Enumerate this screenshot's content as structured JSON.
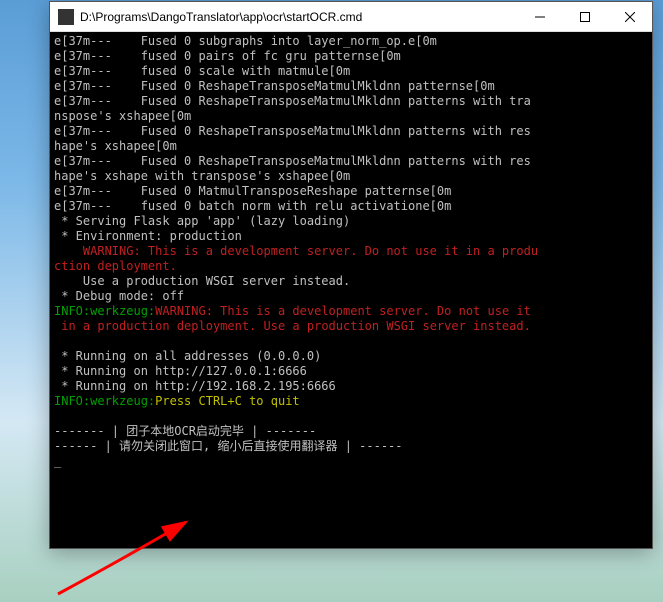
{
  "window": {
    "title": "D:\\Programs\\DangoTranslator\\app\\ocr\\startOCR.cmd"
  },
  "lines": [
    {
      "cls": "gray",
      "text": "e[37m---    Fused 0 subgraphs into layer_norm_op.e[0m"
    },
    {
      "cls": "gray",
      "text": "e[37m---    fused 0 pairs of fc gru patternse[0m"
    },
    {
      "cls": "gray",
      "text": "e[37m---    fused 0 scale with matmule[0m"
    },
    {
      "cls": "gray",
      "text": "e[37m---    Fused 0 ReshapeTransposeMatmulMkldnn patternse[0m"
    },
    {
      "cls": "gray",
      "text": "e[37m---    Fused 0 ReshapeTransposeMatmulMkldnn patterns with tra"
    },
    {
      "cls": "gray",
      "text": "nspose's xshapee[0m"
    },
    {
      "cls": "gray",
      "text": "e[37m---    Fused 0 ReshapeTransposeMatmulMkldnn patterns with res"
    },
    {
      "cls": "gray",
      "text": "hape's xshapee[0m"
    },
    {
      "cls": "gray",
      "text": "e[37m---    Fused 0 ReshapeTransposeMatmulMkldnn patterns with res"
    },
    {
      "cls": "gray",
      "text": "hape's xshape with transpose's xshapee[0m"
    },
    {
      "cls": "gray",
      "text": "e[37m---    Fused 0 MatmulTransposeReshape patternse[0m"
    },
    {
      "cls": "gray",
      "text": "e[37m---    fused 0 batch norm with relu activatione[0m"
    },
    {
      "cls": "gray",
      "text": " * Serving Flask app 'app' (lazy loading)"
    },
    {
      "cls": "gray",
      "text": " * Environment: production"
    },
    {
      "cls": "red",
      "text": "    WARNING: This is a development server. Do not use it in a produ"
    },
    {
      "cls": "red",
      "text": "ction deployment."
    },
    {
      "cls": "gray",
      "text": "    Use a production WSGI server instead."
    },
    {
      "cls": "gray",
      "text": " * Debug mode: off"
    }
  ],
  "warnLine": {
    "prefix": "INFO:werkzeug:",
    "warn1": "WARNING: This is a development server. Do not use it",
    "warn2": " in a production deployment.",
    "warn3": " Use a production WSGI server instead."
  },
  "running": [
    " * Running on all addresses (0.0.0.0)",
    " * Running on http://127.0.0.1:6666",
    " * Running on http://192.168.2.195:6666"
  ],
  "quitLine": {
    "prefix": "INFO:werkzeug:",
    "msg": "Press CTRL+C to quit"
  },
  "footer1": "------- | 团子本地OCR启动完毕 | -------",
  "footer2": "------ | 请勿关闭此窗口, 缩小后直接使用翻译器 | ------",
  "cursor": "_"
}
